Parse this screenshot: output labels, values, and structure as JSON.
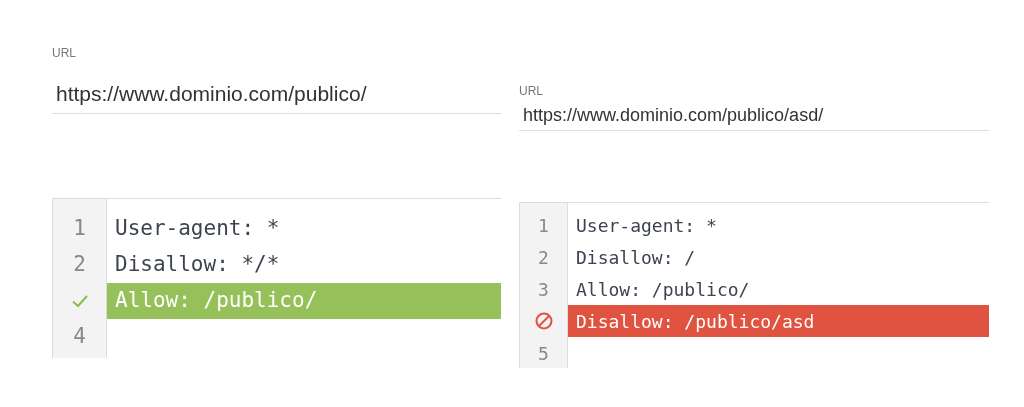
{
  "panels": [
    {
      "label": "URL",
      "url": "https://www.dominio.com/publico/",
      "lines": [
        {
          "number": "1",
          "text": "User-agent: *",
          "kind": "plain"
        },
        {
          "number": "2",
          "text": "Disallow: */*",
          "kind": "plain"
        },
        {
          "text": "Allow: /publico/",
          "kind": "allowed"
        },
        {
          "number": "4",
          "kind": "plain"
        }
      ]
    },
    {
      "label": "URL",
      "url": "https://www.dominio.com/publico/asd/",
      "lines": [
        {
          "number": "1",
          "text": "User-agent: *",
          "kind": "plain"
        },
        {
          "number": "2",
          "text": "Disallow: /",
          "kind": "plain"
        },
        {
          "number": "3",
          "text": "Allow: /publico/",
          "kind": "plain"
        },
        {
          "text": "Disallow: /publico/asd",
          "kind": "blocked"
        },
        {
          "number": "5",
          "kind": "plain"
        }
      ]
    }
  ]
}
